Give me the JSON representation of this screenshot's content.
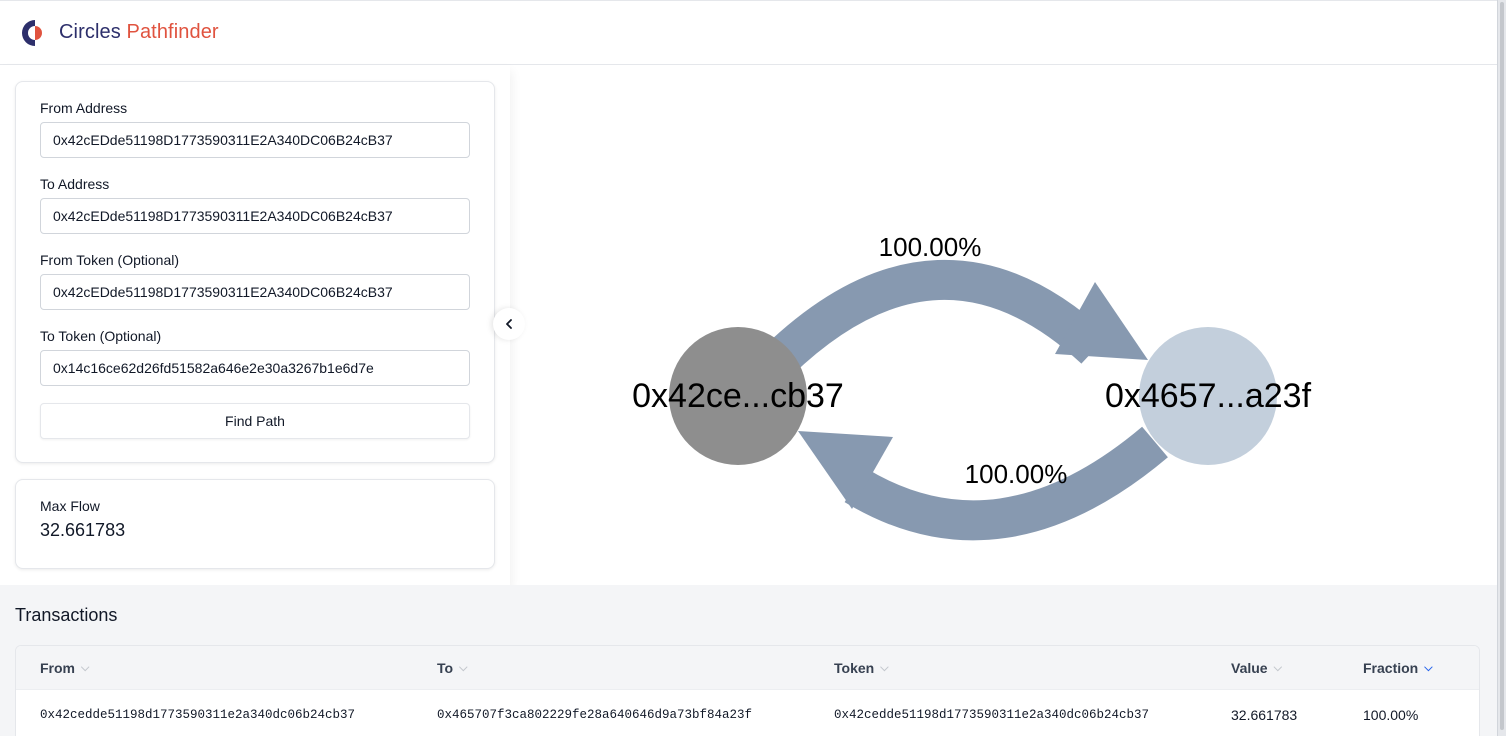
{
  "header": {
    "brand_part1": "Circles",
    "brand_part2": "Pathfinder",
    "logo_icon": "circles-logo-icon"
  },
  "form": {
    "from_address": {
      "label": "From Address",
      "value": "0x42cEDde51198D1773590311E2A340DC06B24cB37"
    },
    "to_address": {
      "label": "To Address",
      "value": "0x42cEDde51198D1773590311E2A340DC06B24cB37"
    },
    "from_token": {
      "label": "From Token (Optional)",
      "value": "0x42cEDde51198D1773590311E2A340DC06B24cB37"
    },
    "to_token": {
      "label": "To Token (Optional)",
      "value": "0x14c16ce62d26fd51582a646e2e30a3267b1e6d7e"
    },
    "find_button": "Find Path"
  },
  "max_flow": {
    "label": "Max Flow",
    "value": "32.661783"
  },
  "collapse_icon": "chevron-left-icon",
  "graph": {
    "nodes": [
      {
        "label": "0x42ce...cb37",
        "color": "#8e8e8e"
      },
      {
        "label": "0x4657...a23f",
        "color": "#c3cfdc"
      }
    ],
    "edges": [
      {
        "label": "100.00%",
        "from": "0x42ce...cb37",
        "to": "0x4657...a23f"
      },
      {
        "label": "100.00%",
        "from": "0x4657...a23f",
        "to": "0x42ce...cb37"
      }
    ],
    "edge_color": "#8799b0"
  },
  "transactions": {
    "title": "Transactions",
    "columns": [
      {
        "label": "From",
        "sorted": false
      },
      {
        "label": "To",
        "sorted": false
      },
      {
        "label": "Token",
        "sorted": false
      },
      {
        "label": "Value",
        "sorted": false
      },
      {
        "label": "Fraction",
        "sorted": true
      }
    ],
    "rows": [
      {
        "from": "0x42cedde51198d1773590311e2a340dc06b24cb37",
        "to": "0x465707f3ca802229fe28a640646d9a73bf84a23f",
        "token": "0x42cedde51198d1773590311e2a340dc06b24cb37",
        "value": "32.661783",
        "fraction": "100.00%"
      }
    ]
  },
  "colors": {
    "brand_dark": "#2d2f6b",
    "brand_accent": "#e0533f",
    "sort_active": "#2563eb"
  }
}
